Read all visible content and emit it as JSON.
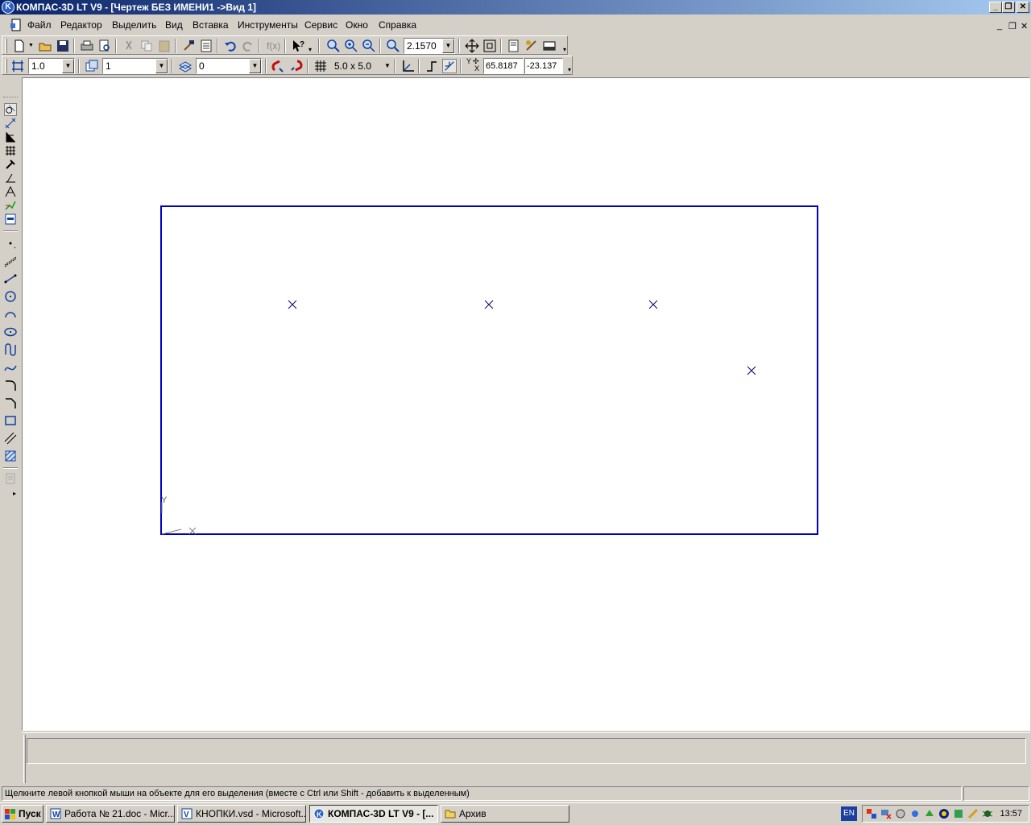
{
  "window": {
    "title": "КОМПАС-3D LT V9 - [Чертеж БЕЗ ИМЕНИ1 ->Вид 1]",
    "controls": [
      "_",
      "❐",
      "✕"
    ]
  },
  "menu": {
    "items": [
      "Файл",
      "Редактор",
      "Выделить",
      "Вид",
      "Вставка",
      "Инструменты",
      "Сервис",
      "Окно",
      "Справка"
    ],
    "mdi_controls": [
      "_",
      "❐",
      "✕"
    ]
  },
  "toolbar_main": {
    "zoom_value": "2.1570"
  },
  "toolbar_props": {
    "line_scale": "1.0",
    "layer_state": "1",
    "layer": "0",
    "grid_step": "5.0 x 5.0",
    "coord_y_label": "Y",
    "coord_x_label": "X",
    "coord_x": "65.8187",
    "coord_y": "-23.137"
  },
  "drawing": {
    "axis_y_label": "Y",
    "axis_x_label": "X",
    "accent_color": "#0000c0",
    "points_count": 4
  },
  "status": {
    "hint": "Щелкните левой кнопкой мыши на объекте для его выделения (вместе с Ctrl или Shift - добавить к выделенным)"
  },
  "taskbar": {
    "start_label": "Пуск",
    "tasks": [
      {
        "label": "Работа № 21.doc - Micr...",
        "icon": "word-icon",
        "active": false
      },
      {
        "label": "КНОПКИ.vsd - Microsoft...",
        "icon": "visio-icon",
        "active": false
      },
      {
        "label": "КОМПАС-3D LT V9 - [...",
        "icon": "kompas-icon",
        "active": true
      },
      {
        "label": "Архив",
        "icon": "folder-icon",
        "active": false
      }
    ],
    "language": "EN",
    "clock": "13:57"
  }
}
